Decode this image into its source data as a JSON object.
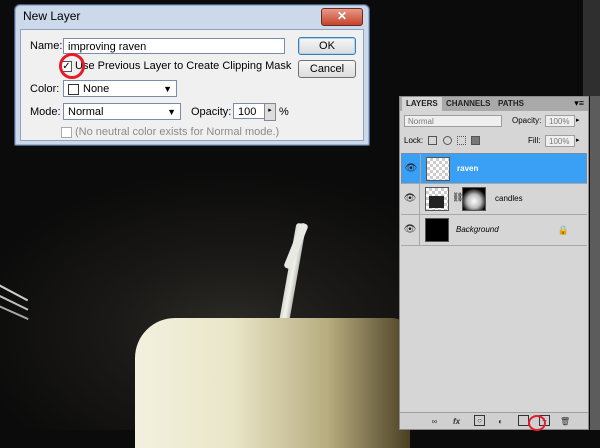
{
  "dialog": {
    "title": "New Layer",
    "close_glyph": "✕",
    "name_label": "Name:",
    "name_value": "improving raven",
    "ok_label": "OK",
    "cancel_label": "Cancel",
    "clip_label": "Use Previous Layer to Create Clipping Mask",
    "clip_checked": "✓",
    "color_label": "Color:",
    "color_value": "None",
    "mode_label": "Mode:",
    "mode_value": "Normal",
    "opacity_label": "Opacity:",
    "opacity_value": "100",
    "opacity_unit": "%",
    "neutral_label": "(No neutral color exists for Normal mode.)"
  },
  "layers_panel": {
    "tabs": [
      "LAYERS",
      "CHANNELS",
      "PATHS"
    ],
    "blend_mode": "Normal",
    "opacity_label": "Opacity:",
    "opacity_value": "100%",
    "lock_label": "Lock:",
    "fill_label": "Fill:",
    "fill_value": "100%",
    "layers": [
      {
        "name": "raven",
        "selected": true
      },
      {
        "name": "candles",
        "selected": false
      },
      {
        "name": "Background",
        "selected": false
      }
    ],
    "footer_icons": [
      "link-icon",
      "fx-icon",
      "mask-icon",
      "adjustment-icon",
      "group-icon",
      "new-layer-icon",
      "trash-icon"
    ]
  },
  "colors": {
    "highlight_circle": "#e51c2a",
    "selected_layer": "#3aa0f5"
  }
}
